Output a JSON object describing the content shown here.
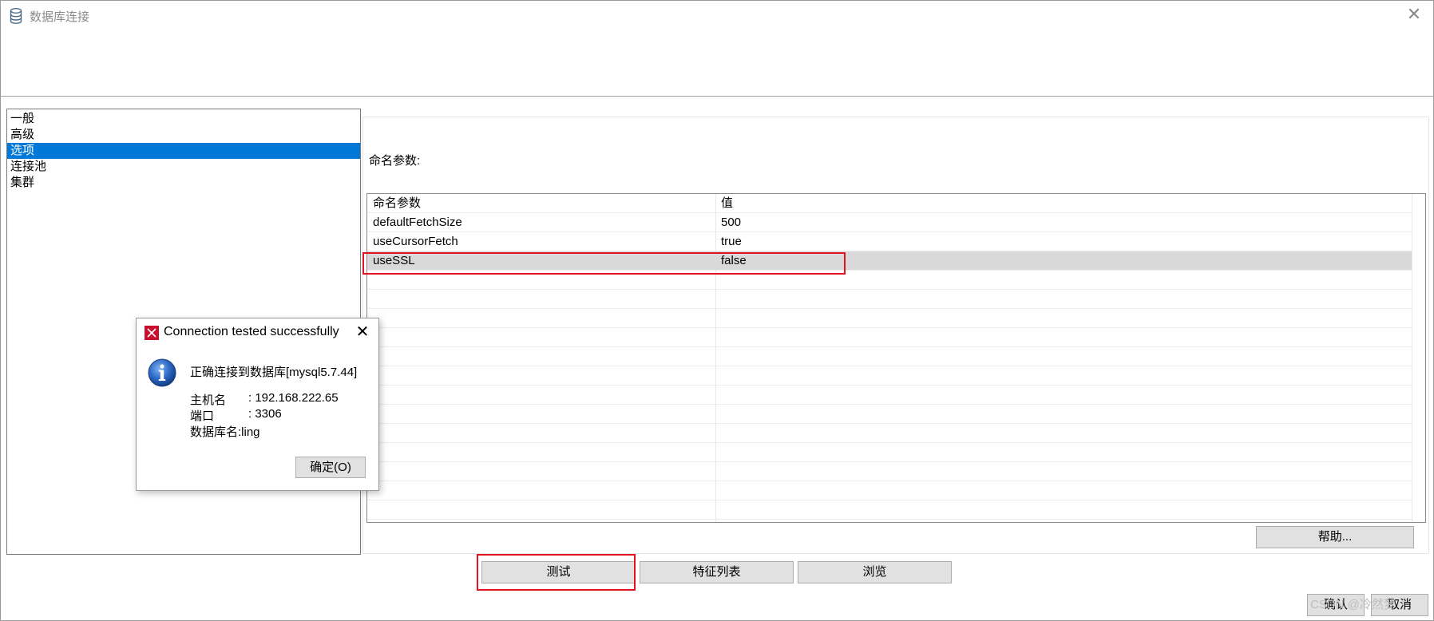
{
  "window": {
    "title": "数据库连接",
    "close_glyph": "✕",
    "icon": "database-icon"
  },
  "nav": {
    "items": [
      {
        "label": "一般",
        "selected": false
      },
      {
        "label": "高级",
        "selected": false
      },
      {
        "label": "选项",
        "selected": true
      },
      {
        "label": "连接池",
        "selected": false
      },
      {
        "label": "集群",
        "selected": false
      }
    ]
  },
  "options": {
    "label": "命名参数:",
    "table": {
      "headers": [
        "命名参数",
        "值"
      ],
      "rows": [
        {
          "name": "defaultFetchSize",
          "value": "500",
          "highlight": false
        },
        {
          "name": "useCursorFetch",
          "value": "true",
          "highlight": false
        },
        {
          "name": "useSSL",
          "value": "false",
          "highlight": true
        }
      ]
    },
    "help_button": "帮助..."
  },
  "actions": {
    "test_button": "测试",
    "features_button": "特征列表",
    "browse_button": "浏览"
  },
  "footer": {
    "ok_button": "确认",
    "cancel_button": "取消",
    "watermark": "CSDN @冷然梦"
  },
  "dialog": {
    "title": "Connection tested successfully",
    "close_glyph": "✕",
    "message": "正确连接到数据库[mysql5.7.44]",
    "host_label": "主机名",
    "host_value": ": 192.168.222.65",
    "port_label": "端口",
    "port_value": ": 3306",
    "dbname_line": "数据库名:ling",
    "ok_button": "确定(O)",
    "icon": "info-icon"
  },
  "colors": {
    "selection": "#0078d7",
    "highlight_row": "#d9d9d9",
    "annotation_red": "#e0141e",
    "button_bg": "#e1e1e1"
  }
}
